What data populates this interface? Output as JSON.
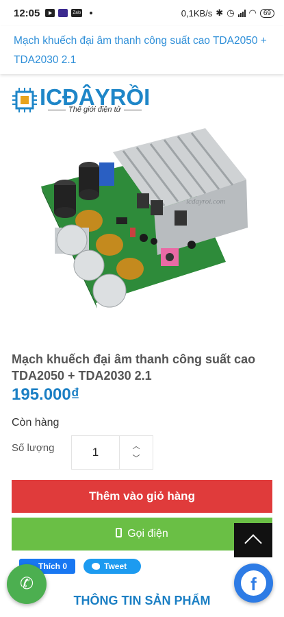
{
  "status_bar": {
    "time": "12:05",
    "net_speed": "0,1KB/s",
    "battery": "69",
    "zalo_label": "Zalo"
  },
  "header": {
    "title": "Mạch khuếch đại âm thanh công suất cao TDA2050 + TDA2030 2.1"
  },
  "logo": {
    "brand": "ICĐÂYRỒI",
    "tagline": "Thế giới điện tử"
  },
  "product": {
    "image_watermark": "icdayroi.com",
    "title": "Mạch khuếch đại âm thanh công suất cao TDA2050 + TDA2030 2.1",
    "price": "195.000₫",
    "stock_status": "Còn hàng",
    "quantity_label": "Số lượng",
    "quantity_value": "1"
  },
  "actions": {
    "add_to_cart": "Thêm vào giỏ hàng",
    "call": "Gọi điện"
  },
  "social": {
    "like_label": "Thích",
    "like_count": "0",
    "tweet_label": "Tweet"
  },
  "floating": {
    "fb_letter": "f",
    "phone_glyph": "✆"
  },
  "section": {
    "info_title": "THÔNG TIN SẢN PHẨM"
  },
  "colors": {
    "brand_blue": "#1b7fc4",
    "cart_red": "#e03b3b",
    "call_green": "#6abf45"
  }
}
